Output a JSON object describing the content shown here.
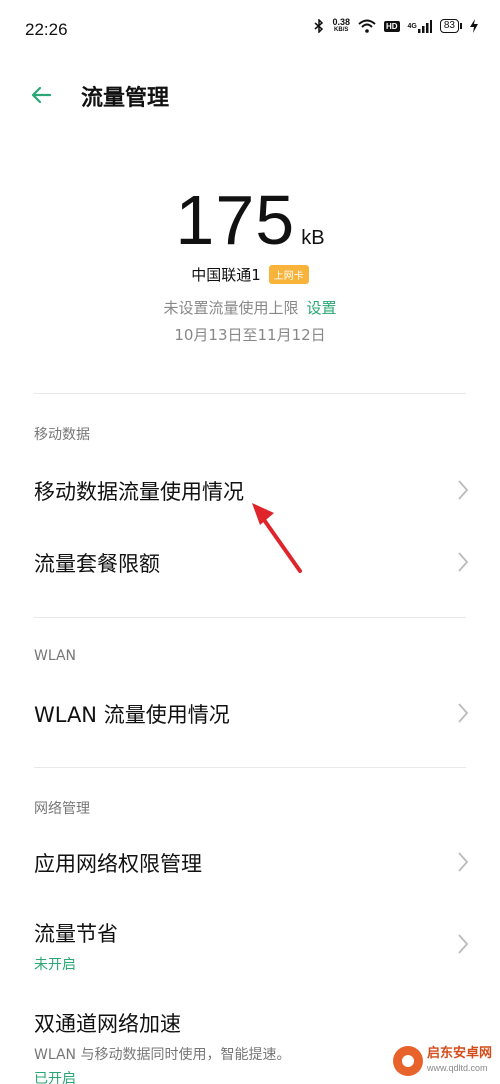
{
  "status_bar": {
    "time": "22:26",
    "net_speed_value": "0.38",
    "net_speed_unit": "KB/S",
    "hd_label": "HD",
    "signal_label": "4G",
    "battery": "83",
    "icons": [
      "bluetooth-icon",
      "wifi-icon",
      "hd-icon",
      "signal-icon",
      "battery-icon",
      "charging-icon"
    ]
  },
  "header": {
    "title": "流量管理"
  },
  "usage": {
    "value": "175",
    "unit": "kB",
    "sim_name": "中国联通1",
    "sim_badge": "上网卡",
    "limit_text": "未设置流量使用上限",
    "set_link": "设置",
    "period": "10月13日至11月12日"
  },
  "sections": {
    "mobile_data": {
      "label": "移动数据",
      "items": [
        {
          "title": "移动数据流量使用情况"
        },
        {
          "title": "流量套餐限额"
        }
      ]
    },
    "wlan": {
      "label": "WLAN",
      "items": [
        {
          "title": "WLAN 流量使用情况"
        }
      ]
    },
    "network": {
      "label": "网络管理",
      "items": [
        {
          "title": "应用网络权限管理"
        },
        {
          "title": "流量节省",
          "subtitle": "未开启"
        },
        {
          "title": "双通道网络加速",
          "description": "WLAN 与移动数据同时使用，智能提速。",
          "subtitle": "已开启"
        }
      ]
    }
  },
  "watermark": {
    "name": "启东安卓网",
    "url": "www.qdltd.com"
  },
  "colors": {
    "accent": "#2aa775",
    "badge": "#f7b33a",
    "annotation_arrow": "#e0242b"
  }
}
